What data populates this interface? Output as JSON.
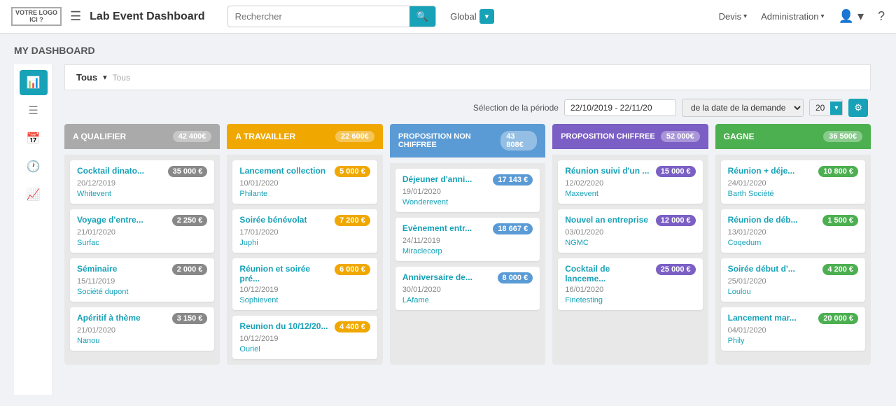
{
  "logo": {
    "line1": "VOTRE LOGO",
    "line2": "ICI ?"
  },
  "app_title": {
    "prefix": "Lab Event ",
    "bold": "Dashboard"
  },
  "search": {
    "placeholder": "Rechercher"
  },
  "global": {
    "label": "Global"
  },
  "nav": {
    "devis": "Devis",
    "administration": "Administration"
  },
  "page_title": "MY DASHBOARD",
  "filter": {
    "active": "Tous",
    "sub": "Tous"
  },
  "period": {
    "label": "Sélection de la période",
    "date_range": "22/10/2019 - 22/11/20",
    "date_type": "de la date de la demande",
    "count": "20"
  },
  "columns": [
    {
      "id": "qualifier",
      "title": "A QUALIFIER",
      "total": "42 400€",
      "color_class": "col-qualifier",
      "amt_class": "amt-gray",
      "cards": [
        {
          "title": "Cocktail dinato...",
          "date": "20/12/2019",
          "company": "Whitevent",
          "amount": "35 000 €"
        },
        {
          "title": "Voyage d'entre...",
          "date": "21/01/2020",
          "company": "Surfac",
          "amount": "2 250 €"
        },
        {
          "title": "Séminaire",
          "date": "15/11/2019",
          "company": "Société dupont",
          "amount": "2 000 €"
        },
        {
          "title": "Apéritif à thème",
          "date": "21/01/2020",
          "company": "Nanou",
          "amount": "3 150 €"
        }
      ]
    },
    {
      "id": "travailler",
      "title": "A TRAVAILLER",
      "total": "22 600€",
      "color_class": "col-travailler",
      "amt_class": "amt-orange",
      "cards": [
        {
          "title": "Lancement collection",
          "date": "10/01/2020",
          "company": "Philante",
          "amount": "5 000 €"
        },
        {
          "title": "Soirée bénévolat",
          "date": "17/01/2020",
          "company": "Juphi",
          "amount": "7 200 €"
        },
        {
          "title": "Réunion et soirée pré...",
          "date": "10/12/2019",
          "company": "Sophievent",
          "amount": "6 000 €"
        },
        {
          "title": "Reunion du 10/12/20...",
          "date": "10/12/2019",
          "company": "Ouriel",
          "amount": "4 400 €"
        }
      ]
    },
    {
      "id": "non-chiffree",
      "title": "PROPOSITION NON CHIFFREE",
      "total": "43 808€",
      "color_class": "col-non-chiffree",
      "amt_class": "amt-blue",
      "cards": [
        {
          "title": "Déjeuner d'anni...",
          "date": "19/01/2020",
          "company": "Wonderevent",
          "amount": "17 143 €"
        },
        {
          "title": "Evènement entr...",
          "date": "24/11/2019",
          "company": "Miraclecorp",
          "amount": "18 667 €"
        },
        {
          "title": "Anniversaire de...",
          "date": "30/01/2020",
          "company": "LAfame",
          "amount": "8 000 €"
        }
      ]
    },
    {
      "id": "chiffree",
      "title": "PROPOSITION CHIFFREE",
      "total": "52 000€",
      "color_class": "col-chiffree",
      "amt_class": "amt-purple",
      "cards": [
        {
          "title": "Réunion suivi d'un ...",
          "date": "12/02/2020",
          "company": "Maxevent",
          "amount": "15 000 €"
        },
        {
          "title": "Nouvel an entreprise",
          "date": "03/01/2020",
          "company": "NGMC",
          "amount": "12 000 €"
        },
        {
          "title": "Cocktail de lanceme...",
          "date": "16/01/2020",
          "company": "Finetesting",
          "amount": "25 000 €"
        }
      ]
    },
    {
      "id": "gagne",
      "title": "GAGNE",
      "total": "36 500€",
      "color_class": "col-gagne",
      "amt_class": "amt-green",
      "cards": [
        {
          "title": "Réunion + déje...",
          "date": "24/01/2020",
          "company": "Barth Société",
          "amount": "10 800 €"
        },
        {
          "title": "Réunion de déb...",
          "date": "13/01/2020",
          "company": "Coqedum",
          "amount": "1 500 €"
        },
        {
          "title": "Soirée début d'...",
          "date": "25/01/2020",
          "company": "Loulou",
          "amount": "4 200 €"
        },
        {
          "title": "Lancement mar...",
          "date": "04/01/2020",
          "company": "Phily",
          "amount": "20 000 €"
        }
      ]
    }
  ],
  "sidebar_icons": [
    "chart-bar-icon",
    "menu-icon",
    "calendar-icon",
    "clock-icon",
    "chart-line-icon"
  ],
  "icons": {
    "hamburger": "☰",
    "search": "🔍",
    "caret_down": "▾",
    "user": "👤",
    "help": "?",
    "gear": "⚙"
  }
}
